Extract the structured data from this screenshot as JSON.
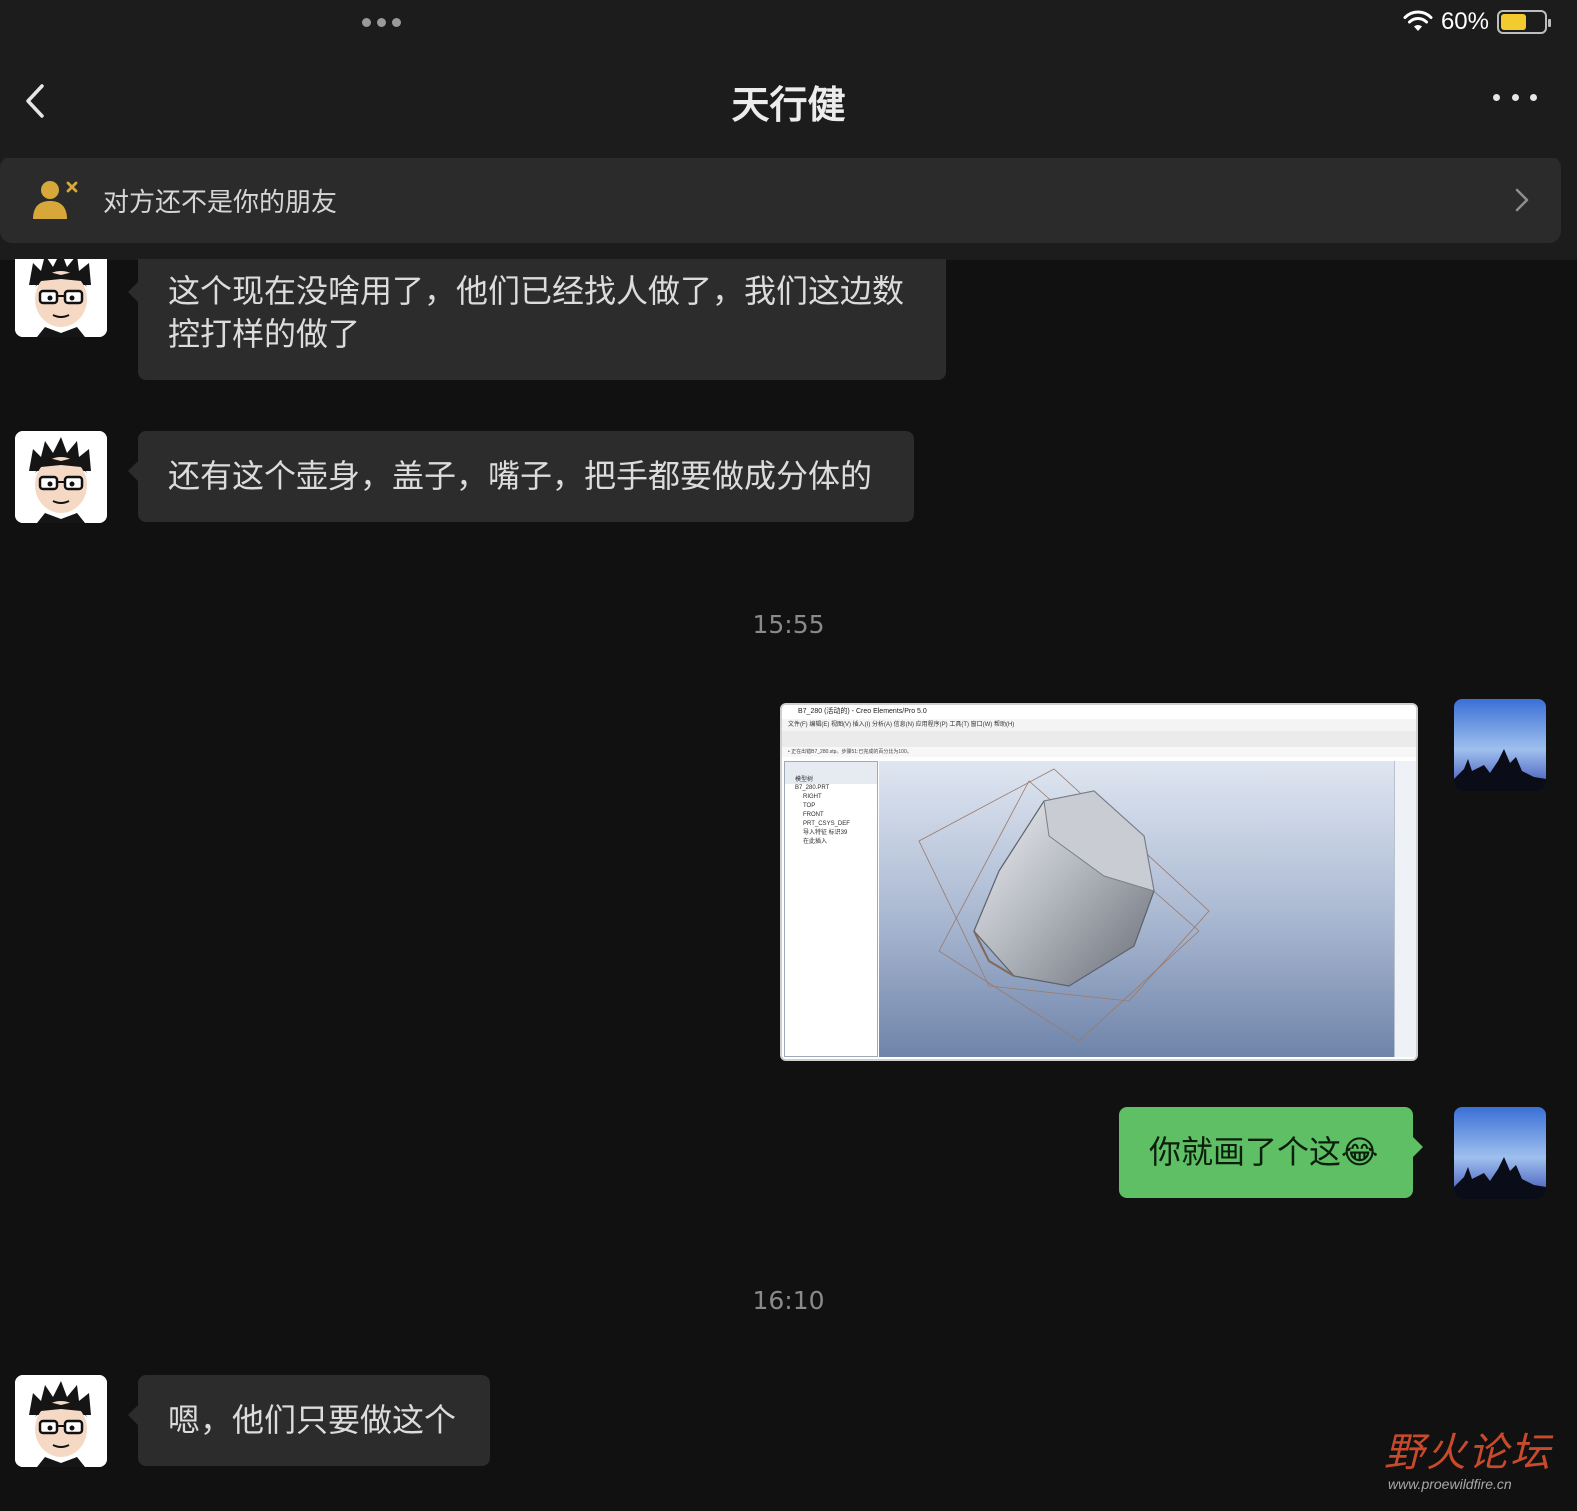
{
  "status_bar": {
    "battery_percent": "60%",
    "battery_level": 0.6,
    "battery_color": "#f2cb2f"
  },
  "header": {
    "title": "天行健",
    "back_icon": "chevron-left-icon",
    "more_icon": "ellipsis-icon"
  },
  "banner": {
    "text": "对方还不是你的朋友",
    "icon": "user-not-friend-icon",
    "icon_color": "#d8a73a"
  },
  "messages": [
    {
      "sender": "contact",
      "type": "text",
      "text_lines": [
        "这个现在没啥用了，他们已经找人做了，我们这边数",
        "控打样的做了"
      ]
    },
    {
      "sender": "contact",
      "type": "text",
      "text": "还有这个壶身，盖子，嘴子，把手都要做成分体的"
    },
    {
      "type": "timestamp",
      "text": "15:55"
    },
    {
      "sender": "me",
      "type": "image",
      "image": {
        "window_title": "B7_280 (活动的) - Creo Elements/Pro 5.0",
        "menu": "文件(F)   编辑(E)   视图(V)   插入(I)   分析(A)   信息(N)   应用程序(P)   工具(T)   窗口(W)   帮助(H)",
        "message_line": "• 正在出错B7_280.stp。步骤51:已完成的百分比为100。",
        "tree_header": "模型树",
        "tree_items": [
          "B7_280.PRT",
          "RIGHT",
          "TOP",
          "FRONT",
          "PRT_CSYS_DEF",
          "导入特征 标识39",
          "在此插入"
        ]
      }
    },
    {
      "sender": "me",
      "type": "text",
      "text": "你就画了个这😂"
    },
    {
      "type": "timestamp",
      "text": "16:10"
    },
    {
      "sender": "contact",
      "type": "text",
      "text": "嗯，他们只要做这个"
    }
  ],
  "watermark": {
    "logo_text": "野火论坛",
    "url": "www.proewildfire.cn"
  },
  "colors": {
    "background": "#111111",
    "header_bg": "#1c1c1c",
    "incoming_bubble": "#2c2c2c",
    "outgoing_bubble": "#5fbf65",
    "timestamp_text": "#8a8a8a"
  }
}
